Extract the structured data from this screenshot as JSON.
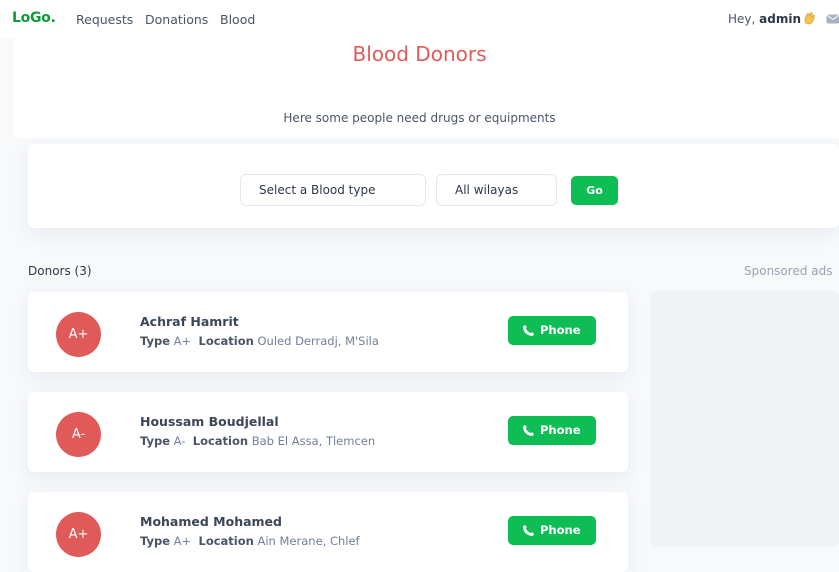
{
  "navbar": {
    "logo": "LoGo.",
    "links": [
      {
        "label": "Requests"
      },
      {
        "label": "Donations"
      },
      {
        "label": "Blood"
      }
    ],
    "greeting_prefix": "Hey,",
    "username": "admin"
  },
  "hero": {
    "title": "Blood Donors",
    "subtitle": "Here some people need drugs or equipments"
  },
  "filters": {
    "blood_type_select": "Select a Blood type",
    "wilaya_select": "All wilayas",
    "go_label": "Go"
  },
  "donors_heading": "Donors (3)",
  "sponsored_label": "Sponsored ads",
  "field_labels": {
    "type": "Type",
    "location": "Location"
  },
  "phone_label": "Phone",
  "donors": [
    {
      "initials": "A+",
      "name": "Achraf Hamrit",
      "type": "A+",
      "location": "Ouled Derradj, M'Sila"
    },
    {
      "initials": "A-",
      "name": "Houssam Boudjellal",
      "type": "A-",
      "location": "Bab El Assa, Tlemcen"
    },
    {
      "initials": "A+",
      "name": "Mohamed Mohamed",
      "type": "A+",
      "location": "Ain Merane, Chlef"
    }
  ],
  "colors": {
    "brand": "#0f9a3a",
    "accent_red": "#e05a59",
    "button_green": "#0fbd55"
  },
  "icons": {
    "greeting": "waving-hand-icon",
    "mail": "mail-icon",
    "phone": "phone-icon"
  }
}
